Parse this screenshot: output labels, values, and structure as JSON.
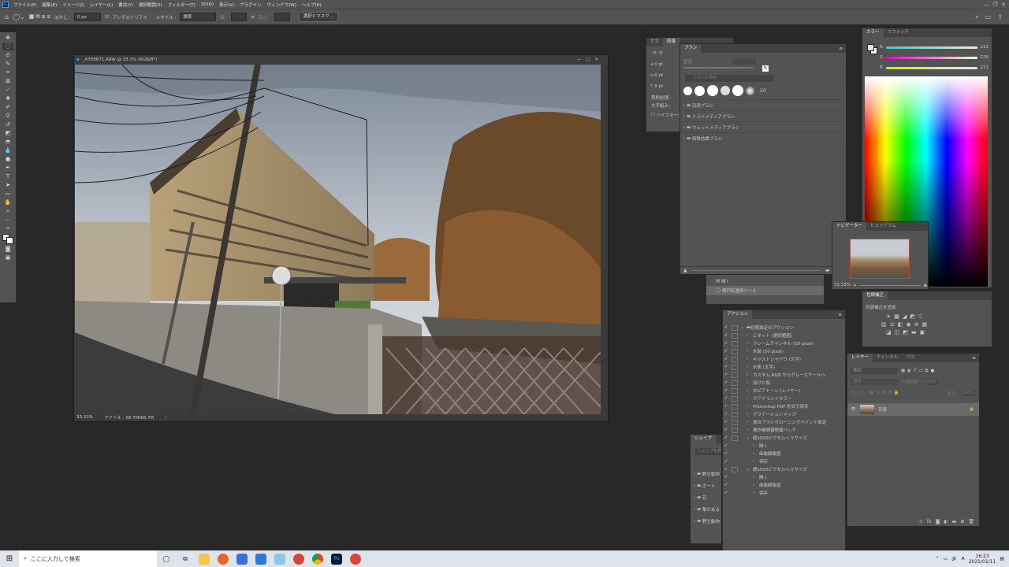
{
  "menubar": {
    "app_icon": "Ps",
    "items": [
      "ファイル(F)",
      "編集(E)",
      "イメージ(I)",
      "レイヤー(L)",
      "書式(Y)",
      "選択範囲(S)",
      "フィルター(T)",
      "3D(D)",
      "表示(V)",
      "プラグイン",
      "ウィンドウ(W)",
      "ヘルプ(H)"
    ]
  },
  "options": {
    "feather_label": "ぼかし :",
    "feather_value": "0 px",
    "antialias_label": "アンチエイリアス",
    "style_label": "スタイル :",
    "style_value": "標準",
    "width_label": "幅 :",
    "height_label": "高さ :",
    "mask_button": "選択とマスク..."
  },
  "document": {
    "title": "_A7E8671.ARW @ 33.3% (RGB/8*)",
    "zoom": "33.33%",
    "file_info": "ファイル : 68.7M/68.7M"
  },
  "char_panel": {
    "tabs": [
      "文字",
      "段落"
    ],
    "indent_values": [
      "0 pt",
      "0 pt",
      "0 pt"
    ],
    "labels": [
      "禁則処理 :",
      "文字組み :",
      "ハイフネーション"
    ]
  },
  "brush_panel": {
    "tab": "ブラシ",
    "size_label": "直径",
    "search_placeholder": "ブラシを検索",
    "brush_size": "20",
    "folders": [
      "汎用ブラシ",
      "ドライメディアブラシ",
      "ウェットメディアブラシ",
      "特殊効果ブラシ"
    ]
  },
  "history_panel": {
    "items": [
      "開く",
      "楕円形選択ツール"
    ]
  },
  "color_panel": {
    "tabs": [
      "カラー",
      "スウォッチ"
    ],
    "r": "231",
    "g": "226",
    "b": "211",
    "r_label": "R",
    "g_label": "G",
    "b_label": "B"
  },
  "navigator_panel": {
    "tabs": [
      "ナビゲーター",
      "ヒストグラム"
    ],
    "zoom": "33.33%"
  },
  "adjust_panel": {
    "tab": "色調補正",
    "add_label": "色調補正を追加"
  },
  "actions_panel": {
    "tab": "アクション",
    "items": [
      {
        "label": "初期設定のアクション",
        "indent": 0,
        "folder": true
      },
      {
        "label": "ビネット (選択範囲)",
        "indent": 1
      },
      {
        "label": "フレームチャンネル (50 pixel)",
        "indent": 1
      },
      {
        "label": "木製 (50 pixel)",
        "indent": 1
      },
      {
        "label": "キャストシャドウ (文字)",
        "indent": 1
      },
      {
        "label": "水面 (文字)",
        "indent": 1
      },
      {
        "label": "カスタム RGB からグレースケールへ",
        "indent": 1
      },
      {
        "label": "溶けた鉛",
        "indent": 1
      },
      {
        "label": "セピアトーン (レイヤー)",
        "indent": 1
      },
      {
        "label": "クアドラントカラー",
        "indent": 1
      },
      {
        "label": "Photoshop PDF 形式で保存",
        "indent": 1
      },
      {
        "label": "グラデーションマップ",
        "indent": 1
      },
      {
        "label": "混合ブラシクローニングペイント設定",
        "indent": 1
      },
      {
        "label": "著作権情報登録パッチ",
        "indent": 1
      },
      {
        "label": "縦1920ピクセルへリサイズ",
        "indent": 1,
        "open": true
      },
      {
        "label": "開く",
        "indent": 2
      },
      {
        "label": "画像解像度",
        "indent": 2
      },
      {
        "label": "保存",
        "indent": 2
      },
      {
        "label": "横1920ピクセルへリサイズ",
        "indent": 1,
        "open": true
      },
      {
        "label": "開く",
        "indent": 2
      },
      {
        "label": "画像解像度",
        "indent": 2
      },
      {
        "label": "保存",
        "indent": 2
      }
    ]
  },
  "shapes_panel": {
    "tab": "シェイプ",
    "search_placeholder": "シェイプを検索",
    "items": [
      "野生動物",
      "ボート",
      "花",
      "葉のある",
      "野生動物"
    ]
  },
  "layers_panel": {
    "tabs": [
      "レイヤー",
      "チャンネル",
      "パス"
    ],
    "kind_placeholder": "種類",
    "blend_mode": "通常",
    "opacity_label": "不透明度 :",
    "opacity": "100%",
    "lock_label": "ロック :",
    "fill_label": "塗り :",
    "fill": "100%",
    "layer_name": "背景"
  },
  "taskbar": {
    "search_placeholder": "ここに入力して検索",
    "ime": "A",
    "time": "16:23",
    "date": "2021/01/11"
  }
}
